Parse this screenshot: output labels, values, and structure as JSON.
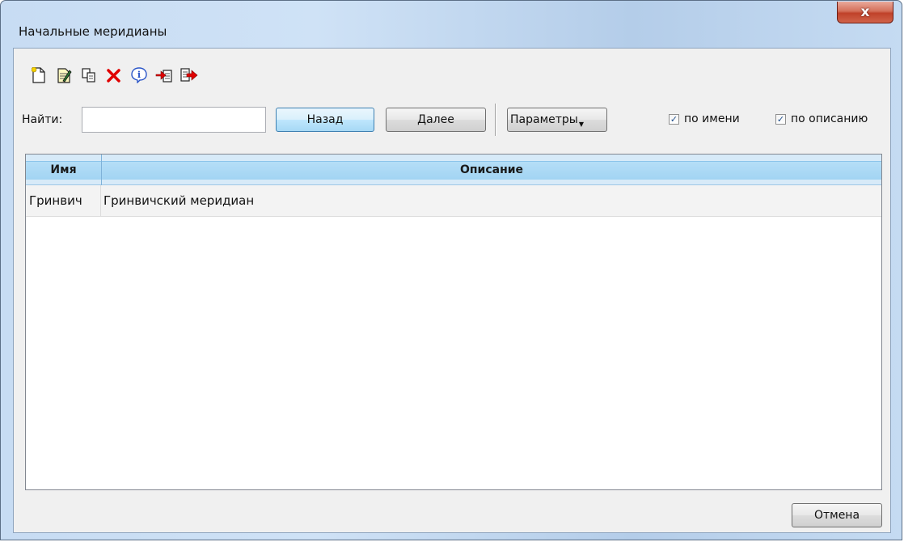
{
  "window": {
    "title": "Начальные меридианы",
    "close_label": "x"
  },
  "toolbar": {
    "items": [
      {
        "icon": "new-document-icon"
      },
      {
        "icon": "edit-document-icon"
      },
      {
        "icon": "copy-icon"
      },
      {
        "icon": "delete-icon"
      },
      {
        "icon": "info-icon"
      },
      {
        "icon": "import-icon"
      },
      {
        "icon": "export-icon"
      }
    ]
  },
  "search": {
    "label": "Найти:",
    "value": "",
    "back_label": "Назад",
    "next_label": "Далее",
    "params_label": "Параметры",
    "by_name_label": "по имени",
    "by_name_checked": true,
    "by_desc_label": "по описанию",
    "by_desc_checked": true
  },
  "table": {
    "columns": [
      "Имя",
      "Описание"
    ],
    "rows": [
      [
        "Гринвич",
        "Гринвичский меридиан"
      ]
    ]
  },
  "footer": {
    "cancel_label": "Отмена"
  },
  "colors": {
    "header_blue": "#a2d4f3",
    "close_red": "#c0422a",
    "delete_red": "#e00000"
  }
}
